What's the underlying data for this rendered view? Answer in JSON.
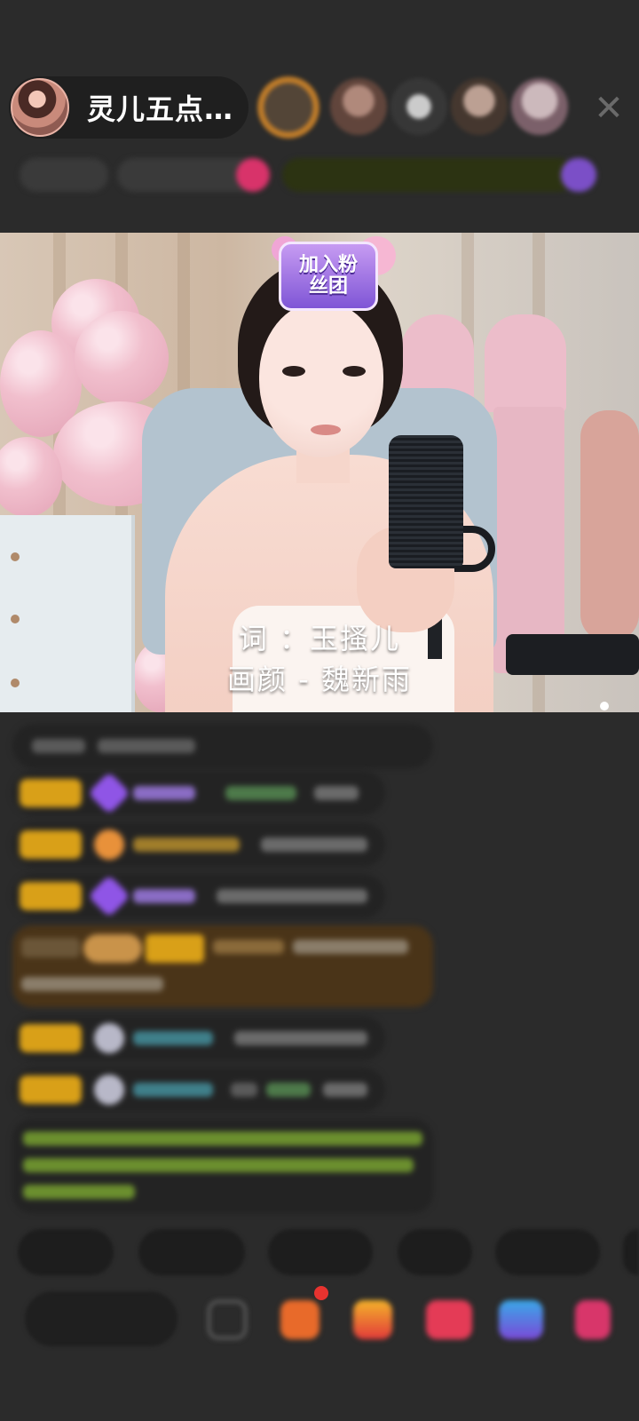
{
  "header": {
    "host_name": "灵儿五点…",
    "close_icon": "close-icon",
    "viewer_count": 5
  },
  "video": {
    "fan_badge_text": "加入粉丝团",
    "lyric_line_1": "词 ：玉搔儿",
    "lyric_line_2": "画颜 - 魏新雨"
  },
  "colors": {
    "background": "#2b2b2b",
    "badge_gold": "#d9a018",
    "badge_purple": "#8f55e6",
    "highlight_brown": "#4a3418",
    "notification_red": "#e8332f",
    "system_text_green": "#8ebf3a"
  },
  "icons": [
    "close-icon",
    "emoji-icon",
    "gift-box-icon",
    "treasure-icon",
    "red-packet-icon",
    "game-icon",
    "more-gifts-icon"
  ]
}
